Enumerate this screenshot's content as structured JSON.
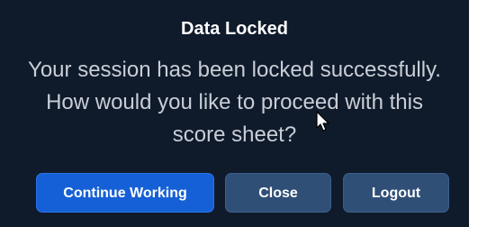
{
  "dialog": {
    "title": "Data Locked",
    "message": "Your session has been locked successfully. How would you like to proceed with this score sheet?",
    "buttons": {
      "continue": "Continue Working",
      "close": "Close",
      "logout": "Logout"
    }
  },
  "colors": {
    "dialog_background": "#0f1a2b",
    "primary_button": "#1560d6",
    "secondary_button": "#2f4f77",
    "message_text": "#c9ced6"
  },
  "icons": {
    "cursor": "mouse-pointer-icon"
  }
}
